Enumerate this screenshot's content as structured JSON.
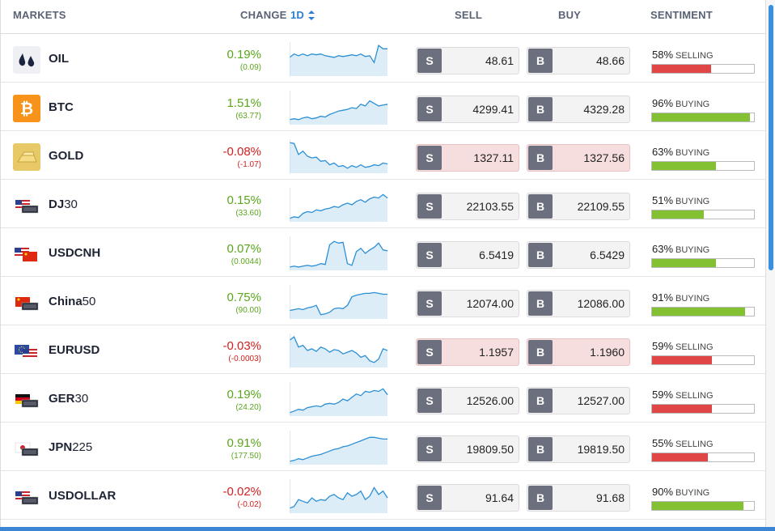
{
  "header": {
    "markets": "MARKETS",
    "change": "CHANGE",
    "period": "1D",
    "sell": "SELL",
    "buy": "BUY",
    "sentiment": "SENTIMENT"
  },
  "buttons": {
    "sell_tag": "S",
    "buy_tag": "B"
  },
  "colors": {
    "up": "#5aa51c",
    "down": "#d32020",
    "selling": "#e04646",
    "buying": "#84c132",
    "spark_line": "#2b8fd6",
    "spark_fill": "#dcedf8"
  },
  "rows": [
    {
      "name": "OIL",
      "suffix": "",
      "icon": "oil-drops-icon",
      "pct": "0.19%",
      "abs": "(0.09)",
      "dir": "up",
      "sell": "48.61",
      "buy": "48.66",
      "highlight": false,
      "sent_pct": "58%",
      "sent_word": "SELLING",
      "sent_value": 58,
      "sent_type": "selling",
      "spark": [
        20,
        24,
        22,
        24,
        22,
        24,
        23,
        24,
        22,
        21,
        20,
        22,
        21,
        22,
        23,
        22,
        24,
        21,
        22,
        14,
        34,
        30,
        30
      ]
    },
    {
      "name": "BTC",
      "suffix": "",
      "icon": "bitcoin-icon",
      "pct": "1.51%",
      "abs": "(63.77)",
      "dir": "up",
      "sell": "4299.41",
      "buy": "4329.28",
      "highlight": false,
      "sent_pct": "96%",
      "sent_word": "BUYING",
      "sent_value": 96,
      "sent_type": "buying",
      "spark": [
        4,
        5,
        4,
        6,
        7,
        5,
        6,
        8,
        7,
        10,
        12,
        14,
        15,
        16,
        18,
        17,
        22,
        20,
        26,
        23,
        20,
        21,
        22
      ]
    },
    {
      "name": "GOLD",
      "suffix": "",
      "icon": "gold-bar-icon",
      "pct": "-0.08%",
      "abs": "(-1.07)",
      "dir": "down",
      "sell": "1327.11",
      "buy": "1327.56",
      "highlight": true,
      "sent_pct": "63%",
      "sent_word": "BUYING",
      "sent_value": 63,
      "sent_type": "buying",
      "spark": [
        34,
        33,
        20,
        24,
        18,
        16,
        17,
        12,
        13,
        8,
        10,
        6,
        7,
        4,
        7,
        5,
        8,
        5,
        6,
        8,
        7,
        10,
        9
      ]
    },
    {
      "name": "DJ",
      "suffix": "30",
      "icon": "us-flag-icon",
      "pct": "0.15%",
      "abs": "(33.60)",
      "dir": "up",
      "sell": "22103.55",
      "buy": "22109.55",
      "highlight": false,
      "sent_pct": "51%",
      "sent_word": "BUYING",
      "sent_value": 51,
      "sent_type": "buying",
      "spark": [
        2,
        4,
        3,
        8,
        10,
        9,
        12,
        11,
        13,
        14,
        16,
        15,
        18,
        20,
        18,
        22,
        24,
        21,
        25,
        27,
        26,
        30,
        26
      ]
    },
    {
      "name": "USDCNH",
      "suffix": "",
      "icon": "us-china-flag-icon",
      "pct": "0.07%",
      "abs": "(0.0044)",
      "dir": "up",
      "sell": "6.5419",
      "buy": "6.5429",
      "highlight": false,
      "sent_pct": "63%",
      "sent_word": "BUYING",
      "sent_value": 63,
      "sent_type": "buying",
      "spark": [
        2,
        3,
        2,
        3,
        4,
        3,
        4,
        6,
        5,
        28,
        32,
        30,
        31,
        6,
        4,
        20,
        24,
        18,
        22,
        25,
        30,
        22,
        21
      ]
    },
    {
      "name": "China",
      "suffix": "50",
      "icon": "china-flag-icon",
      "pct": "0.75%",
      "abs": "(90.00)",
      "dir": "up",
      "sell": "12074.00",
      "buy": "12086.00",
      "highlight": false,
      "sent_pct": "91%",
      "sent_word": "BUYING",
      "sent_value": 91,
      "sent_type": "buying",
      "spark": [
        8,
        9,
        10,
        9,
        11,
        12,
        14,
        3,
        4,
        6,
        10,
        11,
        10,
        14,
        24,
        26,
        27,
        28,
        28,
        29,
        28,
        27,
        27
      ]
    },
    {
      "name": "EURUSD",
      "suffix": "",
      "icon": "eu-us-flag-icon",
      "pct": "-0.03%",
      "abs": "(-0.0003)",
      "dir": "down",
      "sell": "1.1957",
      "buy": "1.1960",
      "highlight": true,
      "sent_pct": "59%",
      "sent_word": "SELLING",
      "sent_value": 59,
      "sent_type": "selling",
      "spark": [
        30,
        34,
        22,
        24,
        18,
        20,
        17,
        22,
        20,
        16,
        19,
        18,
        14,
        16,
        18,
        15,
        10,
        12,
        6,
        4,
        8,
        20,
        18
      ]
    },
    {
      "name": "GER",
      "suffix": "30",
      "icon": "germany-flag-icon",
      "pct": "0.19%",
      "abs": "(24.20)",
      "dir": "up",
      "sell": "12526.00",
      "buy": "12527.00",
      "highlight": false,
      "sent_pct": "59%",
      "sent_word": "SELLING",
      "sent_value": 59,
      "sent_type": "selling",
      "spark": [
        2,
        4,
        6,
        5,
        8,
        9,
        10,
        9,
        12,
        13,
        12,
        14,
        18,
        16,
        20,
        24,
        22,
        27,
        26,
        28,
        27,
        30,
        23
      ]
    },
    {
      "name": "JPN",
      "suffix": "225",
      "icon": "japan-flag-icon",
      "pct": "0.91%",
      "abs": "(177.50)",
      "dir": "up",
      "sell": "19809.50",
      "buy": "19819.50",
      "highlight": false,
      "sent_pct": "55%",
      "sent_word": "SELLING",
      "sent_value": 55,
      "sent_type": "selling",
      "spark": [
        2,
        3,
        5,
        4,
        6,
        8,
        9,
        10,
        12,
        14,
        16,
        17,
        19,
        20,
        22,
        24,
        26,
        28,
        30,
        30,
        29,
        28,
        28
      ]
    },
    {
      "name": "USDOLLAR",
      "suffix": "",
      "icon": "us-dollar-flag-icon",
      "pct": "-0.02%",
      "abs": "(-0.02)",
      "dir": "down",
      "sell": "91.64",
      "buy": "91.68",
      "highlight": false,
      "sent_pct": "90%",
      "sent_word": "BUYING",
      "sent_value": 90,
      "sent_type": "buying",
      "spark": [
        4,
        6,
        14,
        12,
        10,
        16,
        12,
        14,
        13,
        18,
        20,
        16,
        14,
        22,
        18,
        20,
        24,
        14,
        18,
        28,
        20,
        24,
        16
      ]
    }
  ]
}
